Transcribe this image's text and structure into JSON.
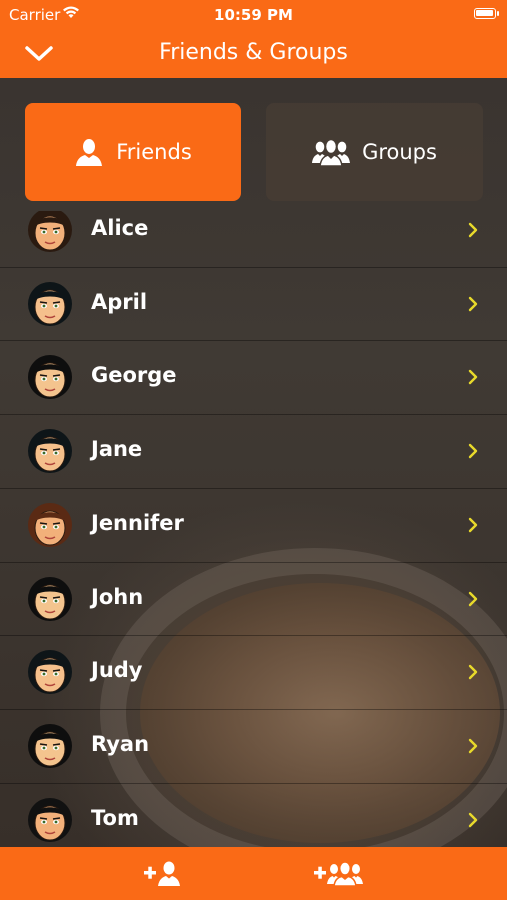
{
  "status_bar": {
    "carrier": "Carrier",
    "time": "10:59 PM"
  },
  "nav": {
    "title": "Friends & Groups",
    "back_icon": "chevron-down-icon"
  },
  "segments": {
    "friends_label": "Friends",
    "groups_label": "Groups",
    "selected": "Friends"
  },
  "friends": [
    {
      "name": "Alice",
      "hair": "#2a1a10",
      "skin": "#f2b07a"
    },
    {
      "name": "April",
      "hair": "#0e1518",
      "skin": "#f5c08c"
    },
    {
      "name": "George",
      "hair": "#0e0e0e",
      "skin": "#f4c48e"
    },
    {
      "name": "Jane",
      "hair": "#0e1518",
      "skin": "#f5c08c"
    },
    {
      "name": "Jennifer",
      "hair": "#5a2a14",
      "skin": "#f2b07a"
    },
    {
      "name": "John",
      "hair": "#0e0e0e",
      "skin": "#f4c48e"
    },
    {
      "name": "Judy",
      "hair": "#0e1518",
      "skin": "#f5c08c"
    },
    {
      "name": "Ryan",
      "hair": "#0e0e0e",
      "skin": "#f4c48e"
    },
    {
      "name": "Tom",
      "hair": "#111111",
      "skin": "#f2b07a"
    }
  ],
  "tab_bar": {
    "add_friend_icon": "add-friend-icon",
    "add_group_icon": "add-group-icon"
  },
  "colors": {
    "accent": "#fa6a16",
    "chevron": "#e8d92b"
  }
}
